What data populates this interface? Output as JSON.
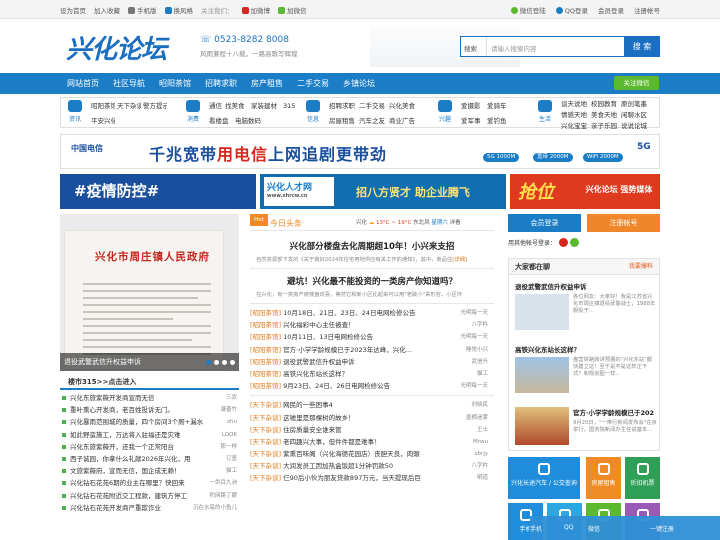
{
  "topbar": {
    "left": [
      "设为首页",
      "加入收藏",
      "手机版",
      "换风格",
      "关注我们：",
      "加微博",
      "加微信"
    ],
    "right": [
      "微信登陆",
      "QQ登录",
      "会员登录",
      "注册帐号"
    ]
  },
  "header": {
    "logo": "兴化论坛",
    "phone": "0523-8282 8008",
    "slogan": "风雨兼程十八载，一路高歌写辉煌",
    "search_scope": "搜索",
    "search_placeholder": "请输入搜索内容",
    "search_button": "搜 索"
  },
  "nav": {
    "items": [
      "网站首页",
      "社区导航",
      "昭阳茶馆",
      "招聘求职",
      "房产租售",
      "二手交易",
      "乡镇论坛"
    ],
    "wechat": "关注微信"
  },
  "categories": [
    {
      "icon": "资讯",
      "links": [
        "昭阳茶馆",
        "天下杂谈",
        "警方提示",
        "平安兴化"
      ]
    },
    {
      "icon": "消费",
      "links": [
        "通信",
        "找美食",
        "家装建材",
        "315",
        "看楼盘",
        "电脑数码"
      ]
    },
    {
      "icon": "信息",
      "links": [
        "招聘求职",
        "二手交易",
        "兴化美食",
        "房屋租售",
        "汽车之友",
        "商业广告"
      ]
    },
    {
      "icon": "兴趣",
      "links": [
        "爱摄影",
        "爱骑车",
        "爱军事",
        "爱钓鱼"
      ]
    },
    {
      "icon": "生活",
      "links": [
        "谈天说地",
        "校园教育",
        "原创笔墨",
        "情感天地",
        "美食天地",
        "闲聊水区",
        "兴化宝宝",
        "亲子乐园",
        "说说论城"
      ]
    }
  ],
  "ads": {
    "telecom_brand": "中国电信",
    "telecom_text_a": "千兆宽带",
    "telecom_text_b": "用电信",
    "telecom_text_c": "上网追剧更带劲",
    "pills": [
      "5G 1000M",
      "宽带 2000M",
      "WiFi 2000M"
    ],
    "five_g": "5G",
    "ad_a": "#疫情防控#",
    "ad_b_brand": "兴化人才网",
    "ad_b_url": "www.xhrcw.cn",
    "ad_b_text": "招八方贤才 助企业腾飞",
    "ad_c_text": "抢位",
    "ad_c_sub": "兴化论坛 强势媒体"
  },
  "slider": {
    "headline_red": "兴化市周庄镇人民政府",
    "caption": "退役武警武信升权益申诉"
  },
  "today": {
    "tag": "Hot",
    "title": "今日头条",
    "weather": {
      "city": "兴化",
      "temp": "13°C ~ 19°C",
      "wind": "东北风",
      "day": "星期六",
      "detail": "详看"
    },
    "headline1": "兴化部分楼盘去化周期超10年！小兴来支招",
    "summary1": "自然资源部下发的《关于做好2024年住宅用地供应有关工作的通知》，其中，商品住",
    "detail": "[详细]",
    "headline2": "避坑！兴化最不能投资的一类房产你知道吗？",
    "summary2": "在兴化，有一类房产被楼盘欢喜，焦然它和新小区比起来可以用\"老破小\"来形容，小区环",
    "items": [
      {
        "cat": "[昭阳茶馆]",
        "title": "10月18日、21日、23日、24日电网检修公告",
        "author": "光明每一天"
      },
      {
        "cat": "[昭阳茶馆]",
        "title": "兴化福彩中心主任被查！",
        "author": "八字杵"
      },
      {
        "cat": "[昭阳茶馆]",
        "title": "10月11日、13日电网检修公告",
        "author": "光明每一天"
      },
      {
        "cat": "[昭阳茶馆]",
        "title": "官方·小学学龄规模已于2023年达峰，兴化...",
        "author": "睡觉小兴"
      },
      {
        "cat": "[昭阳茶馆]",
        "title": "退役武警武信升权益申诉",
        "author": "武信升"
      },
      {
        "cat": "[昭阳茶馆]",
        "title": "高铁兴化东站长这样？",
        "author": "猫工"
      },
      {
        "cat": "[昭阳茶馆]",
        "title": "9月23日、24日、26日电网检修公告",
        "author": "光明每一天"
      },
      {
        "cat": "[天下杂谈]",
        "title": "网民的一些困事4",
        "author": "刘晓民"
      },
      {
        "cat": "[天下杂谈]",
        "title": "这嘘里是那棵树的故乡！",
        "author": "墨栖迷雾"
      },
      {
        "cat": "[天下杂谈]",
        "title": "住房质量安全谁来管",
        "author": "王士"
      },
      {
        "cat": "[天下杂谈]",
        "title": "老四趣兴大事，但件件都是难事！",
        "author": "Mrwu"
      },
      {
        "cat": "[天下杂谈]",
        "title": "紫熏百味阁（兴化海德花园店）丧胆天良，肉頭",
        "author": "xbrjy"
      },
      {
        "cat": "[天下杂谈]",
        "title": "大润发员工因加热盒饭超1分钟罚款50",
        "author": "八字杵"
      },
      {
        "cat": "[天下杂谈]",
        "title": "仨90后小伙为朋友贷款897万元，当天提现后巨",
        "author": "明道"
      }
    ]
  },
  "side": {
    "login": "会员登录",
    "register": "注册帐号",
    "quick_login": "用其他帐号登录：",
    "talk_title": "大家都在聊",
    "talk_more": "我要爆料",
    "talks": [
      {
        "title": "退役武警武信升权益申诉",
        "body": "各位网友：大家好！我是江苏省兴化市周庄镇退役武警战士，1988年服役于..."
      },
      {
        "title": "高铁兴化东站长这样？",
        "body": "盘营铁路跨讲预展的\"兴化东站\"都快建立这！至于是不是这样正下式？和规划图一样..."
      },
      {
        "title": "官方·小学学龄规模已于202",
        "body": "9月20日，\"一带行新闻发布会\"在京举行，国务院新闻办主任说基本..."
      }
    ],
    "tiles": [
      "兴化长途汽车 / 公交查询",
      "房屋租售",
      "折扣机票",
      "手机",
      "QQ",
      "微信",
      "一键注册"
    ]
  },
  "bottom_left": {
    "title": "楼市315>>点击进入",
    "items": [
      {
        "title": "兴化东旅紫薇开发商宣而无信",
        "author": "三农"
      },
      {
        "title": "重叶熏心开发商，老百姓投诉无门。",
        "author": "凝善竹"
      },
      {
        "title": "兴化暴雨范围城的质量，四个房间3个厕+漏水",
        "author": "zhu"
      },
      {
        "title": "如此野蛮施工，万达将入驻福还是灾难",
        "author": "LOOK"
      },
      {
        "title": "兴化东旅紫薇开，还我一个正常阳台",
        "author": "那一样"
      },
      {
        "title": "西子诚园，你拿什么礼献2026年兴化，用",
        "author": "订壹"
      },
      {
        "title": "文旅紫薇府，宣而无信，国企成无赖！",
        "author": "猫工"
      },
      {
        "title": "兴化钻石花苑6期的业主在哪里？快回来",
        "author": "一剑目九洲"
      },
      {
        "title": "兴化钻石花苑附近交工程款，建筑方停工",
        "author": "积网路丁娜"
      },
      {
        "title": "兴化钻石花苑开发商严重欺诈业",
        "author": "沉在水底的小鱼儿"
      }
    ]
  }
}
